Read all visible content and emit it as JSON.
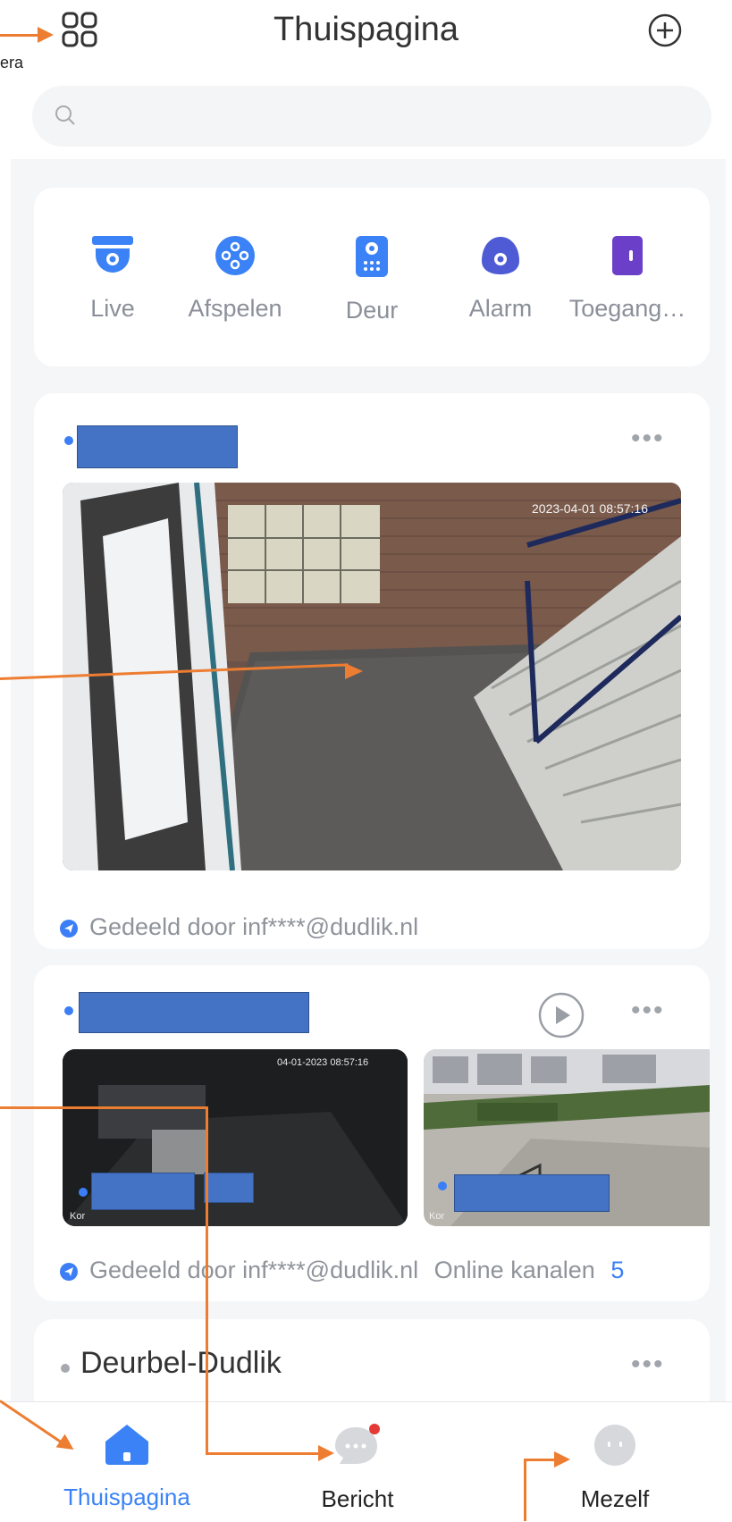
{
  "header": {
    "title": "Thuispagina",
    "corner_note": "era",
    "apps_icon": "grid-icon",
    "add_icon": "plus-circle-icon"
  },
  "search": {
    "placeholder": "",
    "icon": "search-icon"
  },
  "quick_actions": [
    {
      "label": "Live",
      "icon": "camera-dome-icon",
      "color": "#3b82f6"
    },
    {
      "label": "Afspelen",
      "icon": "playback-icon",
      "color": "#3b82f6"
    },
    {
      "label": "Deur",
      "icon": "doorbell-icon",
      "color": "#3b82f6"
    },
    {
      "label": "Alarm",
      "icon": "alarm-icon",
      "color": "#4f5bd5"
    },
    {
      "label": "Toegang…",
      "icon": "access-icon",
      "color": "#6c3fc9"
    }
  ],
  "device_card_1": {
    "camera_timestamp": "2023-04-01 08:57:16",
    "shared_text": "Gedeeld door inf****@dudlik.nl"
  },
  "device_card_2": {
    "cam1_timestamp": "04-01-2023 08:57:16",
    "cam_prefix_1": "Kor",
    "cam_prefix_2": "Kor",
    "shared_text": "Gedeeld door inf****@dudlik.nl",
    "online_label": "Online kanalen",
    "online_count": "5"
  },
  "device_card_3": {
    "name": "Deurbel-Dudlik"
  },
  "bottom_nav": [
    {
      "label": "Thuispagina",
      "icon": "home-icon",
      "active": true
    },
    {
      "label": "Bericht",
      "icon": "message-icon",
      "active": false
    },
    {
      "label": "Mezelf",
      "icon": "profile-icon",
      "active": false
    }
  ],
  "colors": {
    "accent": "#3b82f6",
    "annotation_arrow": "#ed7d31",
    "redaction": "#4472c4"
  }
}
